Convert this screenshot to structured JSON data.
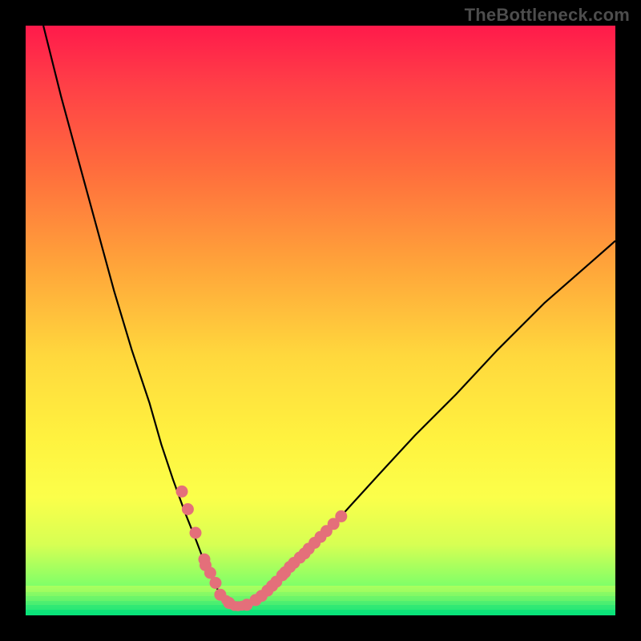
{
  "watermark": "TheBottleneck.com",
  "colors": {
    "page_bg": "#000000",
    "gradient_top": "#ff1a4b",
    "gradient_bottom": "#08e27a",
    "curve": "#000000",
    "dot": "#e46f7a"
  },
  "chart_data": {
    "type": "line",
    "title": "",
    "xlabel": "",
    "ylabel": "",
    "xlim": [
      0,
      100
    ],
    "ylim": [
      0,
      100
    ],
    "x": [
      3,
      6,
      9,
      12,
      15,
      18,
      21,
      23,
      25,
      27,
      29,
      30.5,
      32,
      33,
      34,
      35,
      36,
      37.5,
      39.5,
      42,
      46,
      50,
      55,
      60,
      66,
      73,
      80,
      88,
      96,
      100
    ],
    "y": [
      100,
      88,
      77,
      66,
      55,
      45,
      36,
      29,
      23,
      17.5,
      12.5,
      8.5,
      5.5,
      3.5,
      2.2,
      1.6,
      1.5,
      1.8,
      2.8,
      4.8,
      8.5,
      13,
      18.5,
      24,
      30.5,
      37.5,
      45,
      53,
      60,
      63.5
    ],
    "markers": {
      "left_cluster_x": [
        26.5,
        27.5,
        28.8,
        30.3,
        30.5,
        31.3,
        32.2,
        33.0,
        34.5
      ],
      "left_cluster_y": [
        21.0,
        18.0,
        14.0,
        9.5,
        8.5,
        7.2,
        5.5,
        3.5,
        2.1
      ],
      "right_cluster_x": [
        37.5,
        39.0,
        40.0,
        41.0,
        41.8,
        42.5,
        43.5,
        44.0,
        44.8,
        45.5,
        46.5,
        47.3,
        48.0,
        49.0,
        50.0,
        51.0,
        52.2,
        53.5
      ],
      "right_cluster_y": [
        1.8,
        2.6,
        3.3,
        4.2,
        5.0,
        5.7,
        6.8,
        7.3,
        8.2,
        8.9,
        9.8,
        10.5,
        11.3,
        12.3,
        13.3,
        14.3,
        15.5,
        16.8
      ],
      "bottom_cluster_x": [
        34.0,
        34.8,
        35.4,
        36.0,
        36.7
      ],
      "bottom_cluster_y": [
        2.6,
        1.9,
        1.6,
        1.55,
        1.65
      ]
    },
    "green_bands": [
      {
        "y0": 0.0,
        "y1": 1.0,
        "color": "#08e27a"
      },
      {
        "y0": 1.0,
        "y1": 1.8,
        "color": "#34e874"
      },
      {
        "y0": 1.8,
        "y1": 2.5,
        "color": "#5cef6f"
      },
      {
        "y0": 2.5,
        "y1": 3.2,
        "color": "#85f566"
      },
      {
        "y0": 3.2,
        "y1": 3.9,
        "color": "#a8fb5e"
      },
      {
        "y0": 3.9,
        "y1": 5.0,
        "color": "#ccff57"
      }
    ]
  }
}
